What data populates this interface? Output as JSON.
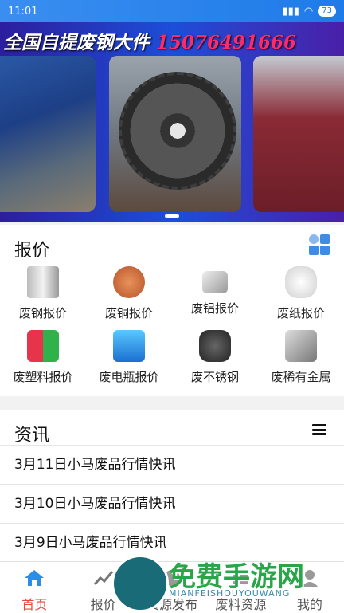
{
  "status": {
    "time": "11:01",
    "battery": "73"
  },
  "banner": {
    "title": "全国自提废钢大件",
    "phone": "15076491666"
  },
  "price_section": {
    "title": "报价",
    "categories": [
      {
        "label": "废钢报价",
        "icon": "steel-pipes-icon"
      },
      {
        "label": "废铜报价",
        "icon": "copper-wire-icon"
      },
      {
        "label": "废铝报价",
        "icon": "aluminum-icon"
      },
      {
        "label": "废纸报价",
        "icon": "paper-icon"
      },
      {
        "label": "废塑料报价",
        "icon": "plastic-icon"
      },
      {
        "label": "废电瓶报价",
        "icon": "battery-icon"
      },
      {
        "label": "废不锈钢",
        "icon": "stainless-icon"
      },
      {
        "label": "废稀有金属",
        "icon": "rare-metal-icon"
      }
    ]
  },
  "news_section": {
    "title": "资讯",
    "items": [
      "3月11日小马废品行情快讯",
      "3月10日小马废品行情快讯",
      "3月9日小马废品行情快讯"
    ]
  },
  "bottom_nav": [
    {
      "label": "首页",
      "active": true
    },
    {
      "label": "报价",
      "active": false
    },
    {
      "label": "资源发布",
      "active": false
    },
    {
      "label": "废料资源",
      "active": false
    },
    {
      "label": "我的",
      "active": false
    }
  ],
  "watermark": {
    "text": "免费手游网",
    "sub": "MIANFEISHOUYOUWANG"
  }
}
